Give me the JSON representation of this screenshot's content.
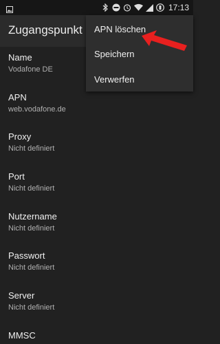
{
  "status_bar": {
    "time": "17:13",
    "icons": [
      "image-icon",
      "bluetooth-icon",
      "do-not-disturb-icon",
      "alarm-icon",
      "wifi-icon",
      "signal-icon",
      "battery-icon"
    ]
  },
  "toolbar": {
    "title": "Zugangspunkt be"
  },
  "fields": [
    {
      "label": "Name",
      "value": "Vodafone DE"
    },
    {
      "label": "APN",
      "value": "web.vodafone.de"
    },
    {
      "label": "Proxy",
      "value": "Nicht definiert"
    },
    {
      "label": "Port",
      "value": "Nicht definiert"
    },
    {
      "label": "Nutzername",
      "value": "Nicht definiert"
    },
    {
      "label": "Passwort",
      "value": "Nicht definiert"
    },
    {
      "label": "Server",
      "value": "Nicht definiert"
    },
    {
      "label": "MMSC",
      "value": ""
    }
  ],
  "menu": {
    "items": [
      "APN löschen",
      "Speichern",
      "Verwerfen"
    ]
  },
  "colors": {
    "background": "#212121",
    "menu": "#2e2e2e",
    "annotation_arrow": "#e8201f"
  }
}
